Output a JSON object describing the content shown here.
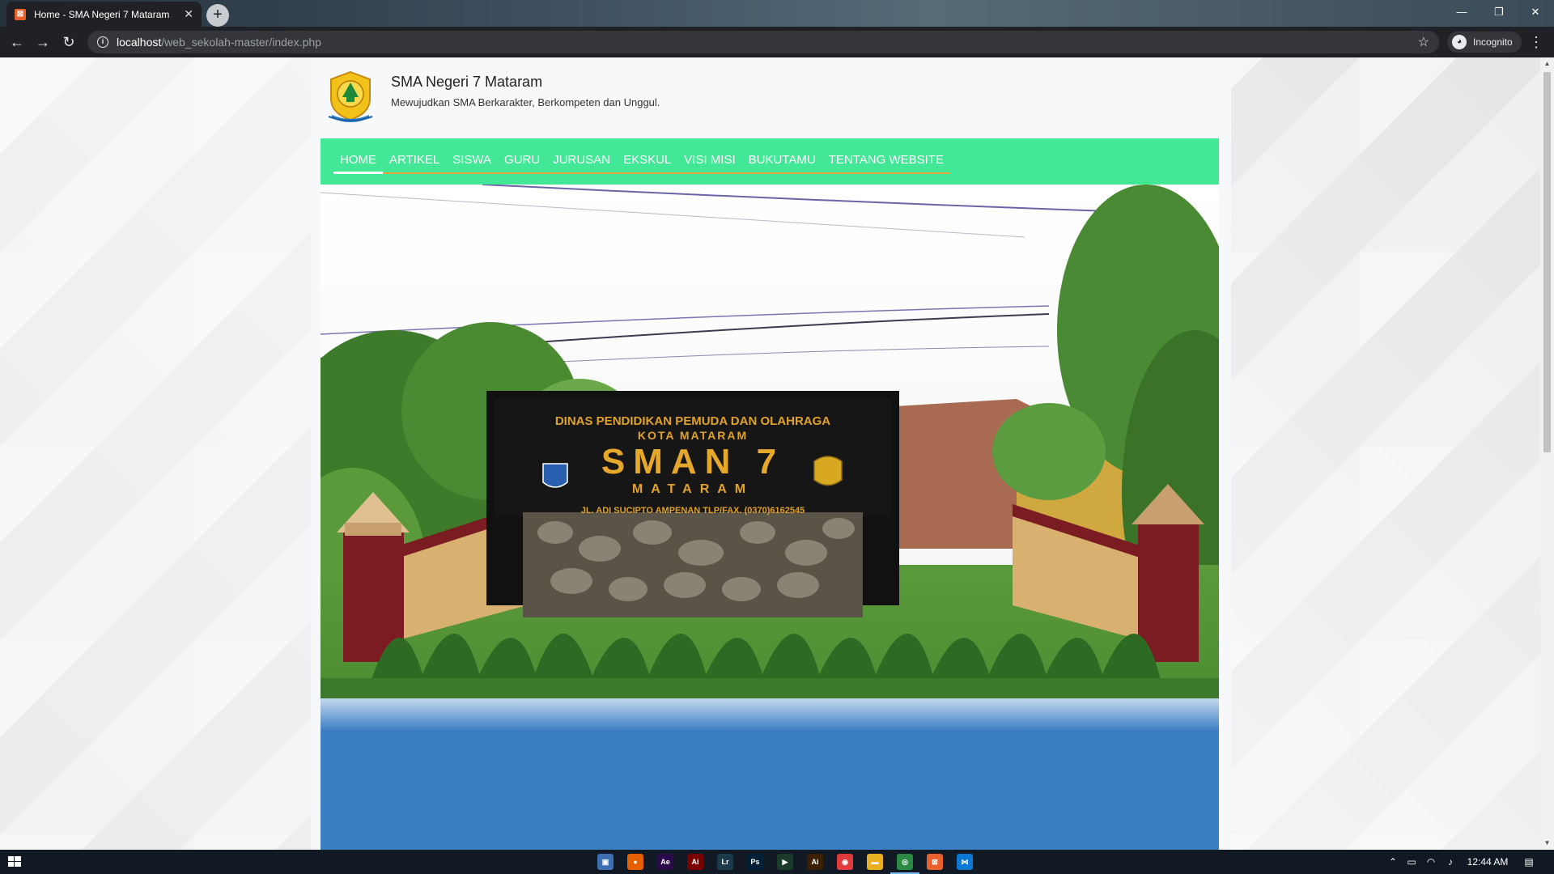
{
  "browser": {
    "tab_title": "Home - SMA Negeri 7 Mataram",
    "tab_close": "✕",
    "new_tab": "+",
    "url_host": "localhost",
    "url_path": "/web_sekolah-master/index.php",
    "profile_label": "Incognito",
    "window_controls": {
      "minimize": "—",
      "maximize": "❐",
      "close": "✕"
    }
  },
  "site": {
    "title": "SMA Negeri 7 Mataram",
    "tagline": "Mewujudkan SMA Berkarakter, Berkompeten dan Unggul."
  },
  "nav": {
    "items": [
      {
        "label": "HOME",
        "active": true
      },
      {
        "label": "ARTIKEL"
      },
      {
        "label": "SISWA"
      },
      {
        "label": "GURU"
      },
      {
        "label": "JURUSAN"
      },
      {
        "label": "EKSKUL"
      },
      {
        "label": "VISI MISI"
      },
      {
        "label": "BUKUTAMU"
      },
      {
        "label": "TENTANG WEBSITE"
      }
    ]
  },
  "hero": {
    "sign_line1": "DINAS PENDIDIKAN PEMUDA DAN OLAHRAGA",
    "sign_line2": "KOTA MATARAM",
    "sign_main": "SMAN 7",
    "sign_city": "MATARAM",
    "sign_address": "JL. ADI SUCIPTO AMPENAN TLP/FAX. (0370)6162545"
  },
  "taskbar": {
    "apps": [
      {
        "name": "virtualbox-icon",
        "color": "#3e6fb3",
        "glyph": "▣"
      },
      {
        "name": "firefox-icon",
        "color": "#e66000",
        "glyph": "●"
      },
      {
        "name": "after-effects-icon",
        "color": "#2a0a4a",
        "glyph": "Ae"
      },
      {
        "name": "acrobat-icon",
        "color": "#7a0000",
        "glyph": "Ai"
      },
      {
        "name": "lightroom-icon",
        "color": "#1c3a4c",
        "glyph": "Lr"
      },
      {
        "name": "photoshop-icon",
        "color": "#001e36",
        "glyph": "Ps"
      },
      {
        "name": "media-encoder-icon",
        "color": "#1a3a2a",
        "glyph": "▶"
      },
      {
        "name": "illustrator-icon",
        "color": "#3a2000",
        "glyph": "Ai"
      },
      {
        "name": "screen-recorder-icon",
        "color": "#e03a3a",
        "glyph": "◉"
      },
      {
        "name": "file-explorer-icon",
        "color": "#e8b020",
        "glyph": "▬"
      },
      {
        "name": "chrome-icon",
        "color": "#2a8a44",
        "glyph": "◎",
        "active": true
      },
      {
        "name": "xampp-icon",
        "color": "#e8612c",
        "glyph": "⊠"
      },
      {
        "name": "vscode-icon",
        "color": "#0a78d4",
        "glyph": "⋈"
      }
    ],
    "clock": "12:44 AM"
  }
}
